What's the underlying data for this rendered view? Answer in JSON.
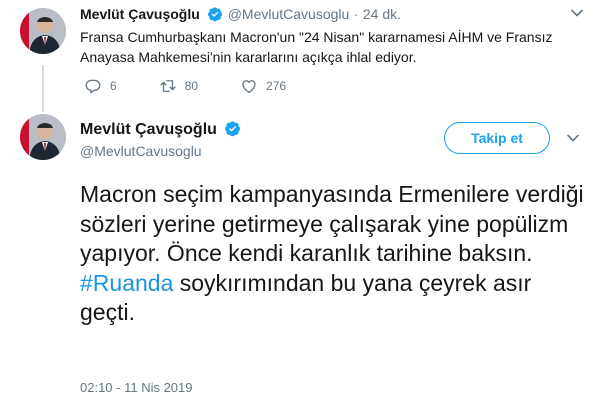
{
  "parent_tweet": {
    "name": "Mevlüt Çavuşoğlu",
    "handle": "@MevlutCavusoglu",
    "separator": "·",
    "time": "24 dk.",
    "text": "Fransa Cumhurbaşkanı Macron'un \"24 Nisan\" kararnamesi AİHM ve Fransız Anayasa Mahkemesi'nin kararlarını açıkça ihlal ediyor.",
    "replies": "6",
    "retweets": "80",
    "likes": "276"
  },
  "main_tweet": {
    "name": "Mevlüt Çavuşoğlu",
    "handle": "@MevlutCavusoglu",
    "follow_label": "Takip et",
    "text_before": "Macron seçim kampanyasında Ermenilere verdiği sözleri yerine getirmeye çalışarak  yine popülizm yapıyor. Önce kendi karanlık tarihine baksın.",
    "hashtag": "#Ruanda",
    "text_after": "soykırımından bu yana çeyrek asır geçti.",
    "timestamp": "02:10 - 11 Nis 2019"
  },
  "colors": {
    "accent": "#1da1f2",
    "hashtag": "#1b95e0",
    "muted": "#657786",
    "text": "#14171a"
  },
  "icons": [
    "verified-badge-icon",
    "chevron-down-icon",
    "reply-icon",
    "retweet-icon",
    "like-icon"
  ]
}
